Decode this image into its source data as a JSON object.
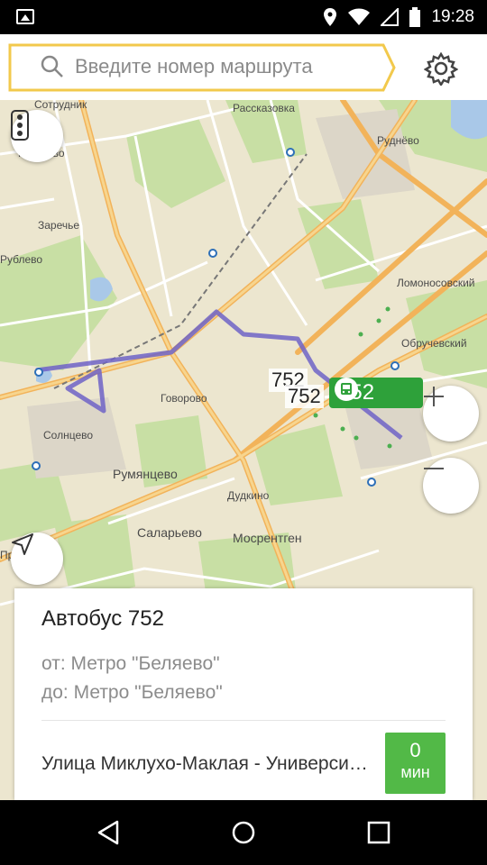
{
  "status": {
    "time": "19:28"
  },
  "search": {
    "placeholder": "Введите номер маршрута"
  },
  "map": {
    "labels": [
      "Сотрудник",
      "Коньково",
      "Заречье",
      "Рублево",
      "Рассказовка",
      "Говорово",
      "Солнцево",
      "Румянцево",
      "Саларьево",
      "Дудкино",
      "Мосрентген",
      "Обручевский",
      "Ломоносовский",
      "Пропоть",
      "Руднёво"
    ],
    "route_label_1": "752",
    "route_label_2": "752",
    "bus_badge": "752"
  },
  "card": {
    "title": "Автобус 752",
    "from": "от: Метро \"Беляево\"",
    "to": "до: Метро \"Беляево\"",
    "stop": "Улица Миклухо-Маклая - Университет",
    "eta_value": "0",
    "eta_unit": "мин"
  },
  "colors": {
    "accent": "#f2c94c",
    "route": "#6f63c7",
    "bus": "#2ea13a",
    "eta": "#52b947"
  }
}
